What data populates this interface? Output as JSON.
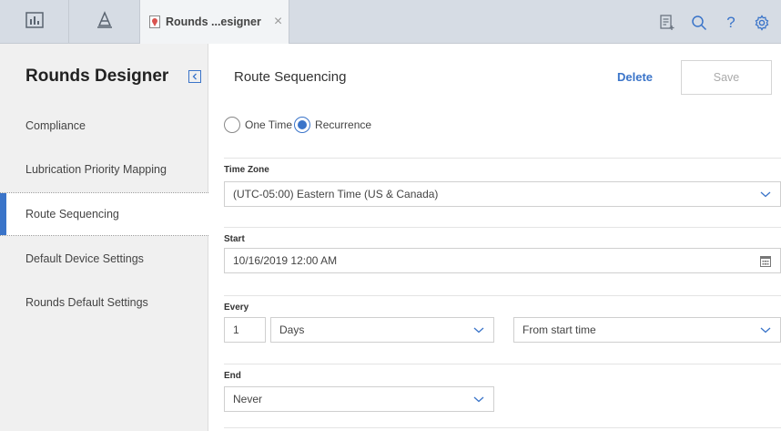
{
  "topbar": {
    "dashboard_icon": "dashboard-icon",
    "tree_icon": "hierarchy-icon",
    "tab_icon": "map-pin-icon",
    "tab_label": "Rounds ...esigner",
    "close_symbol": "×",
    "right_icons": [
      "document-add-icon",
      "search-icon",
      "help-icon",
      "gear-icon"
    ],
    "help_symbol": "?"
  },
  "sidebar": {
    "title": "Rounds Designer",
    "items": [
      {
        "label": "Compliance"
      },
      {
        "label": "Lubrication Priority Mapping"
      },
      {
        "label": "Route Sequencing"
      },
      {
        "label": "Default Device Settings"
      },
      {
        "label": "Rounds Default Settings"
      }
    ],
    "active_item": "Route Sequencing"
  },
  "main": {
    "title": "Route Sequencing",
    "delete_label": "Delete",
    "save_label": "Save",
    "schedule_type": {
      "options": [
        "One Time",
        "Recurrence"
      ],
      "selected": "Recurrence"
    },
    "time_zone": {
      "label": "Time Zone",
      "value": "(UTC-05:00) Eastern Time (US & Canada)"
    },
    "start": {
      "label": "Start",
      "value": "10/16/2019 12:00 AM"
    },
    "every": {
      "label": "Every",
      "count": "1",
      "unit": "Days",
      "from": "From start time"
    },
    "end": {
      "label": "End",
      "value": "Never"
    }
  },
  "colors": {
    "accent": "#3a74c9",
    "topbar_bg": "#d6dce4",
    "sidebar_bg": "#f0f0f0"
  }
}
